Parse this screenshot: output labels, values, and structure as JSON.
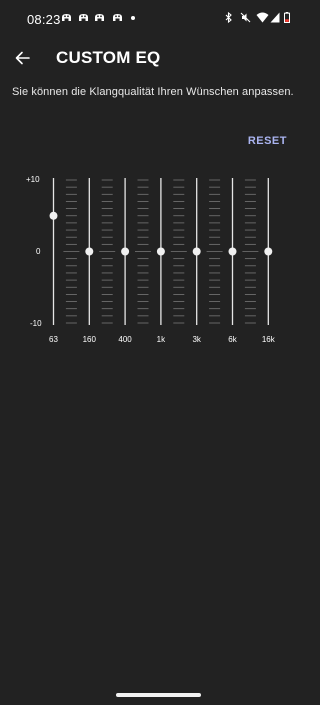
{
  "status": {
    "time": "08:23"
  },
  "header": {
    "title": "CUSTOM EQ"
  },
  "description": "Sie können die Klangqualität Ihren Wünschen anpassen.",
  "reset_label": "RESET",
  "eq": {
    "db_labels": {
      "top": "+10",
      "mid": "0",
      "bottom": "-10"
    },
    "range_db": [
      -10,
      10
    ],
    "bands": [
      {
        "freq": "63",
        "gain_db": 5
      },
      {
        "freq": "160",
        "gain_db": 0
      },
      {
        "freq": "400",
        "gain_db": 0
      },
      {
        "freq": "1k",
        "gain_db": 0
      },
      {
        "freq": "3k",
        "gain_db": 0
      },
      {
        "freq": "6k",
        "gain_db": 0
      },
      {
        "freq": "16k",
        "gain_db": 0
      }
    ]
  }
}
